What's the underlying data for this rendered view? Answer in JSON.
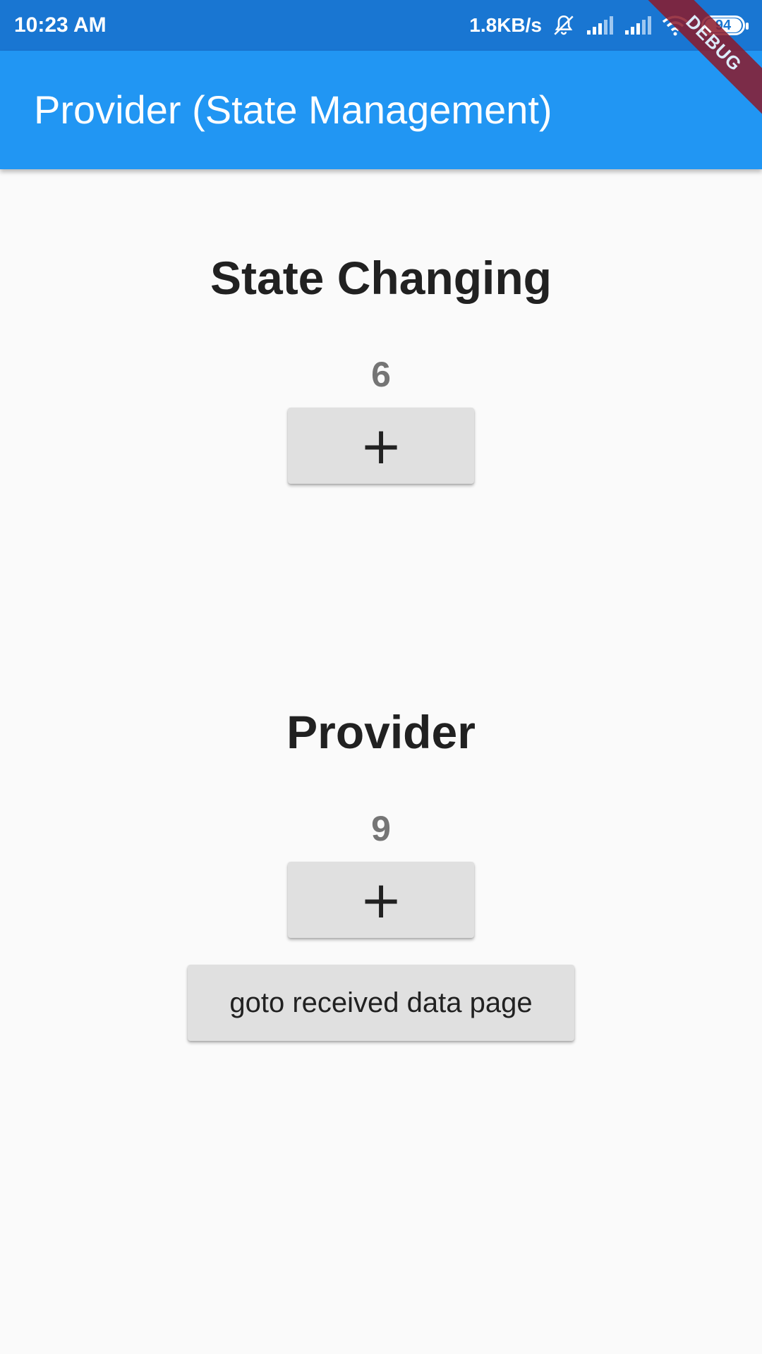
{
  "status_bar": {
    "time": "10:23 AM",
    "network_speed": "1.8KB/s",
    "icons": [
      "mute-bell-icon",
      "signal-icon",
      "signal-icon",
      "wifi-icon",
      "battery-icon"
    ],
    "battery_level": "94",
    "background_color": "#1976d2"
  },
  "app_bar": {
    "title": "Provider (State Management)",
    "background_color": "#2196f3"
  },
  "debug_banner": {
    "label": "DEBUG"
  },
  "state_section": {
    "title": "State Changing",
    "counter": "6",
    "increment_button_icon": "+"
  },
  "provider_section": {
    "title": "Provider",
    "counter": "9",
    "increment_button_icon": "+",
    "goto_button_label": "goto received data page"
  }
}
